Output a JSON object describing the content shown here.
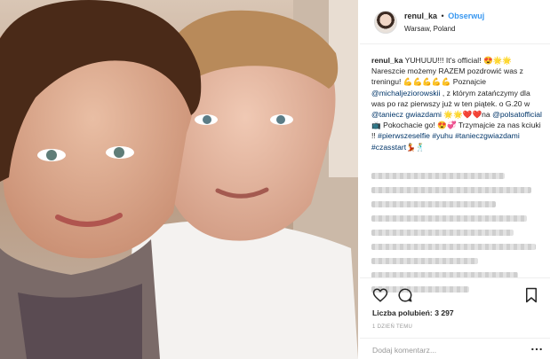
{
  "post": {
    "username": "renul_ka",
    "separator": "•",
    "follow_label": "Obserwuj",
    "location": "Warsaw, Poland",
    "caption": {
      "username": "renul_ka",
      "text_1": " YUHUUU!!! It's official! 😍🌟🌟 Nareszcie możemy RAZEM pozdrowić was z treningu! 💪💪💪💪💪 Poznajcie ",
      "mention_1": "@michaljeziorowskii",
      "text_2": " , z którym zatańczymy dla was po raz pierwszy już w ten piątek. o G.20 w ",
      "mention_2": "@taniecz gwiazdami",
      "text_3": " 🌟🌟❤️❤️na ",
      "mention_3": "@polsatofficial",
      "text_4": " 📺 Pokochacie go! 😍💞 Trzymajcie za nas kciuki !! ",
      "hashtag_1": "#pierwszeselfie",
      "hashtag_2": "#yuhu",
      "hashtag_3": "#tanieczgwiazdami",
      "hashtag_4": "#czasstart",
      "text_5": "💃🕺"
    },
    "likes_label": "Liczba polubień:",
    "likes_count": "3 297",
    "time_ago": "1 DZIEŃ TEMU",
    "comment_placeholder": "Dodaj komentarz..."
  },
  "icons": {
    "like": "heart-icon",
    "comment": "comment-icon",
    "save": "bookmark-icon",
    "more": "more-options-icon"
  },
  "colors": {
    "link": "#003569",
    "follow": "#3897f0",
    "text": "#262626",
    "muted": "#999999",
    "divider": "#efefef"
  }
}
